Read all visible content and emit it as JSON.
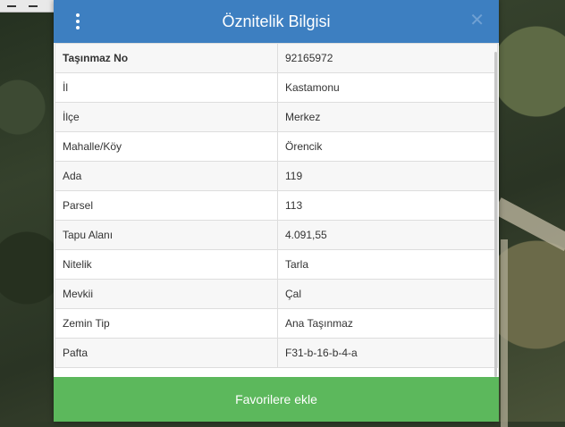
{
  "header": {
    "title": "Öznitelik Bilgisi",
    "close_label": "✕"
  },
  "rows": [
    {
      "key": "Taşınmaz No",
      "value": "92165972"
    },
    {
      "key": "İl",
      "value": "Kastamonu"
    },
    {
      "key": "İlçe",
      "value": "Merkez"
    },
    {
      "key": "Mahalle/Köy",
      "value": "Örencik"
    },
    {
      "key": "Ada",
      "value": "119"
    },
    {
      "key": "Parsel",
      "value": "113"
    },
    {
      "key": "Tapu Alanı",
      "value": "4.091,55"
    },
    {
      "key": "Nitelik",
      "value": "Tarla"
    },
    {
      "key": "Mevkii",
      "value": "Çal"
    },
    {
      "key": "Zemin Tip",
      "value": "Ana Taşınmaz"
    },
    {
      "key": "Pafta",
      "value": "F31-b-16-b-4-a"
    }
  ],
  "footer": {
    "favorite_label": "Favorilere ekle"
  },
  "colors": {
    "header": "#3d7fc1",
    "button": "#5cb85c"
  }
}
